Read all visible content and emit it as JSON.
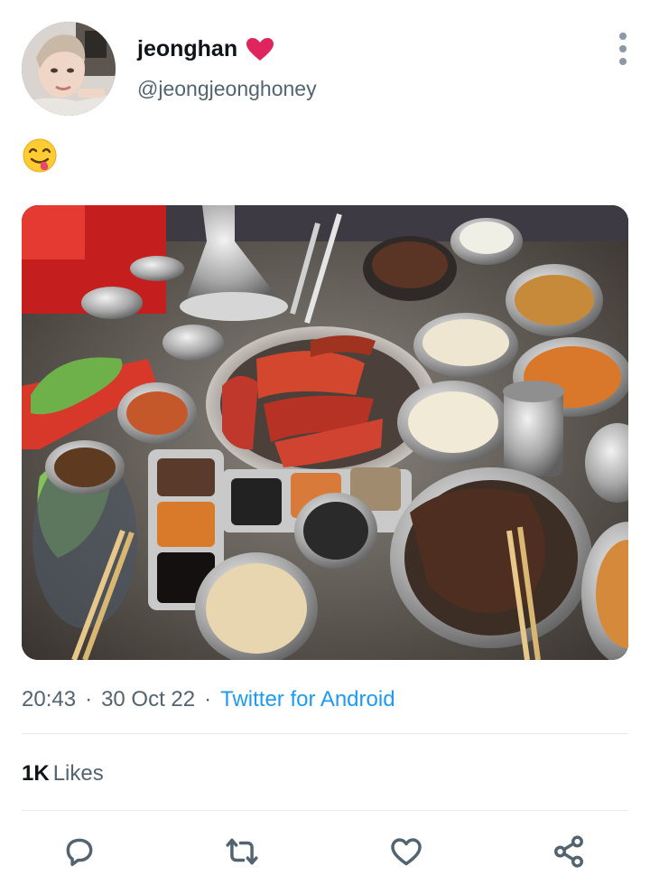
{
  "user": {
    "display_name": "jeonghan",
    "name_emoji": "heart",
    "handle": "@jeongjeonghoney"
  },
  "tweet": {
    "text_emoji": "face-savoring-food"
  },
  "meta": {
    "time": "20:43",
    "date": "30 Oct 22",
    "separator": "·",
    "source": "Twitter for Android"
  },
  "stats": {
    "likes_count": "1K",
    "likes_label": "Likes"
  },
  "actions": [
    "reply",
    "retweet",
    "like",
    "share"
  ],
  "colors": {
    "link": "#1d9bf0",
    "secondary_text": "#536471",
    "heart": "#e0245e"
  }
}
